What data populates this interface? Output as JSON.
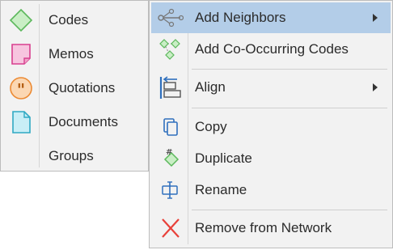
{
  "submenu": {
    "items": [
      {
        "label": "Codes",
        "icon": "code-diamond-icon",
        "color": "#7cc576"
      },
      {
        "label": "Memos",
        "icon": "memo-icon",
        "color": "#e0559e"
      },
      {
        "label": "Quotations",
        "icon": "quotation-icon",
        "color": "#f0913a"
      },
      {
        "label": "Documents",
        "icon": "document-icon",
        "color": "#3bb6cf"
      },
      {
        "label": "Groups",
        "icon": "",
        "color": ""
      }
    ]
  },
  "context_menu": {
    "items": [
      {
        "label": "Add Neighbors",
        "icon": "add-neighbors-icon",
        "has_submenu": true,
        "highlighted": true
      },
      {
        "label": "Add Co-Occurring Codes",
        "icon": "co-occurring-codes-icon",
        "has_submenu": false
      },
      {
        "label": "Align",
        "icon": "align-icon",
        "has_submenu": true
      },
      {
        "label": "Copy",
        "icon": "copy-icon",
        "has_submenu": false
      },
      {
        "label": "Duplicate",
        "icon": "duplicate-icon",
        "has_submenu": false
      },
      {
        "label": "Rename",
        "icon": "rename-icon",
        "has_submenu": false
      },
      {
        "label": "Remove from Network",
        "icon": "remove-icon",
        "has_submenu": false
      }
    ]
  },
  "colors": {
    "highlight": "#b3cde8",
    "menu_bg": "#f2f2f2",
    "accent_blue": "#2f6fbd",
    "remove_red": "#e8413a"
  }
}
